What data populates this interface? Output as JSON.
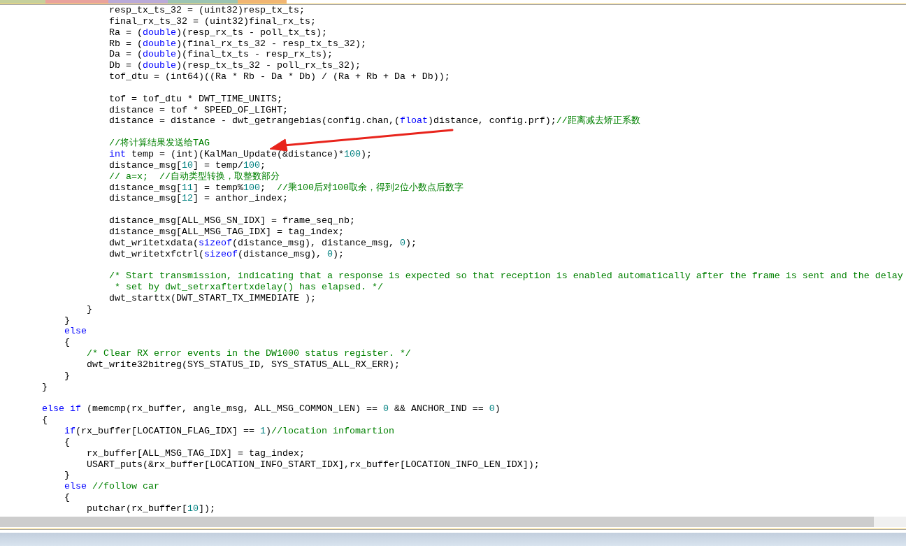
{
  "tabs": [
    {
      "color": "#c6d09c"
    },
    {
      "color": "#e9a39c"
    },
    {
      "color": "#baaad8"
    },
    {
      "color": "#9cc4b2"
    },
    {
      "color": "#f1b673"
    }
  ],
  "editor": {
    "lines": [
      {
        "kind": "code",
        "tokens": [
          {
            "kind": "plain",
            "text": "                resp_tx_ts_32 = (uint32)resp_tx_ts;"
          }
        ]
      },
      {
        "kind": "code",
        "tokens": [
          {
            "kind": "plain",
            "text": "                final_rx_ts_32 = (uint32)final_rx_ts;"
          }
        ]
      },
      {
        "kind": "code",
        "tokens": [
          {
            "kind": "plain",
            "text": "                Ra = ("
          },
          {
            "kind": "keyword",
            "text": "double"
          },
          {
            "kind": "plain",
            "text": ")(resp_rx_ts - poll_tx_ts);"
          }
        ]
      },
      {
        "kind": "code",
        "tokens": [
          {
            "kind": "plain",
            "text": "                Rb = ("
          },
          {
            "kind": "keyword",
            "text": "double"
          },
          {
            "kind": "plain",
            "text": ")(final_rx_ts_32 - resp_tx_ts_32);"
          }
        ]
      },
      {
        "kind": "code",
        "tokens": [
          {
            "kind": "plain",
            "text": "                Da = ("
          },
          {
            "kind": "keyword",
            "text": "double"
          },
          {
            "kind": "plain",
            "text": ")(final_tx_ts - resp_rx_ts);"
          }
        ]
      },
      {
        "kind": "code",
        "tokens": [
          {
            "kind": "plain",
            "text": "                Db = ("
          },
          {
            "kind": "keyword",
            "text": "double"
          },
          {
            "kind": "plain",
            "text": ")(resp_tx_ts_32 - poll_rx_ts_32);"
          }
        ]
      },
      {
        "kind": "code",
        "tokens": [
          {
            "kind": "plain",
            "text": "                tof_dtu = (int64)((Ra * Rb - Da * Db) / (Ra + Rb + Da + Db));"
          }
        ]
      },
      {
        "kind": "blank"
      },
      {
        "kind": "code",
        "tokens": [
          {
            "kind": "plain",
            "text": "                tof = tof_dtu * DWT_TIME_UNITS;"
          }
        ]
      },
      {
        "kind": "code",
        "tokens": [
          {
            "kind": "plain",
            "text": "                distance = tof * SPEED_OF_LIGHT;"
          }
        ]
      },
      {
        "kind": "code",
        "tokens": [
          {
            "kind": "plain",
            "text": "                distance = distance - dwt_getrangebias(config.chan,("
          },
          {
            "kind": "keyword",
            "text": "float"
          },
          {
            "kind": "plain",
            "text": ")distance, config.prf);"
          },
          {
            "kind": "comment",
            "text": "//距离减去矫正系数"
          }
        ]
      },
      {
        "kind": "blank"
      },
      {
        "kind": "code",
        "tokens": [
          {
            "kind": "comment",
            "text": "                //将计算结果发送给TAG"
          }
        ]
      },
      {
        "kind": "code",
        "tokens": [
          {
            "kind": "keyword",
            "text": "                int"
          },
          {
            "kind": "plain",
            "text": " temp = (int)(KalMan_Update(&distance)*"
          },
          {
            "kind": "number",
            "text": "100"
          },
          {
            "kind": "plain",
            "text": ");"
          }
        ]
      },
      {
        "kind": "code",
        "tokens": [
          {
            "kind": "plain",
            "text": "                distance_msg["
          },
          {
            "kind": "number",
            "text": "10"
          },
          {
            "kind": "plain",
            "text": "] = temp/"
          },
          {
            "kind": "number",
            "text": "100"
          },
          {
            "kind": "plain",
            "text": ";"
          }
        ]
      },
      {
        "kind": "code",
        "tokens": [
          {
            "kind": "comment",
            "text": "                // a=x;  //自动类型转换，取整数部分"
          }
        ]
      },
      {
        "kind": "code",
        "tokens": [
          {
            "kind": "plain",
            "text": "                distance_msg["
          },
          {
            "kind": "number",
            "text": "11"
          },
          {
            "kind": "plain",
            "text": "] = temp%"
          },
          {
            "kind": "number",
            "text": "100"
          },
          {
            "kind": "plain",
            "text": ";  "
          },
          {
            "kind": "comment",
            "text": "//乘100后对100取余，得到2位小数点后数字"
          }
        ]
      },
      {
        "kind": "code",
        "tokens": [
          {
            "kind": "plain",
            "text": "                distance_msg["
          },
          {
            "kind": "number",
            "text": "12"
          },
          {
            "kind": "plain",
            "text": "] = anthor_index;"
          }
        ]
      },
      {
        "kind": "blank"
      },
      {
        "kind": "code",
        "tokens": [
          {
            "kind": "plain",
            "text": "                distance_msg[ALL_MSG_SN_IDX] = frame_seq_nb;"
          }
        ]
      },
      {
        "kind": "code",
        "tokens": [
          {
            "kind": "plain",
            "text": "                distance_msg[ALL_MSG_TAG_IDX] = tag_index;"
          }
        ]
      },
      {
        "kind": "code",
        "tokens": [
          {
            "kind": "plain",
            "text": "                dwt_writetxdata("
          },
          {
            "kind": "keyword",
            "text": "sizeof"
          },
          {
            "kind": "plain",
            "text": "(distance_msg), distance_msg, "
          },
          {
            "kind": "number",
            "text": "0"
          },
          {
            "kind": "plain",
            "text": ");"
          }
        ]
      },
      {
        "kind": "code",
        "tokens": [
          {
            "kind": "plain",
            "text": "                dwt_writetxfctrl("
          },
          {
            "kind": "keyword",
            "text": "sizeof"
          },
          {
            "kind": "plain",
            "text": "(distance_msg), "
          },
          {
            "kind": "number",
            "text": "0"
          },
          {
            "kind": "plain",
            "text": ");"
          }
        ]
      },
      {
        "kind": "blank"
      },
      {
        "kind": "code",
        "tokens": [
          {
            "kind": "comment",
            "text": "                /* Start transmission, indicating that a response is expected so that reception is enabled automatically after the frame is sent and the delay"
          }
        ]
      },
      {
        "kind": "code",
        "tokens": [
          {
            "kind": "comment",
            "text": "                 * set by dwt_setrxaftertxdelay() has elapsed. */"
          }
        ]
      },
      {
        "kind": "code",
        "tokens": [
          {
            "kind": "plain",
            "text": "                dwt_starttx(DWT_START_TX_IMMEDIATE );"
          }
        ]
      },
      {
        "kind": "code",
        "tokens": [
          {
            "kind": "plain",
            "text": "            }"
          }
        ]
      },
      {
        "kind": "code",
        "tokens": [
          {
            "kind": "plain",
            "text": "        }"
          }
        ]
      },
      {
        "kind": "code",
        "tokens": [
          {
            "kind": "keyword",
            "text": "        else"
          }
        ]
      },
      {
        "kind": "code",
        "tokens": [
          {
            "kind": "plain",
            "text": "        {"
          }
        ]
      },
      {
        "kind": "code",
        "tokens": [
          {
            "kind": "comment",
            "text": "            /* Clear RX error events in the DW1000 status register. */"
          }
        ]
      },
      {
        "kind": "code",
        "tokens": [
          {
            "kind": "plain",
            "text": "            dwt_write32bitreg(SYS_STATUS_ID, SYS_STATUS_ALL_RX_ERR);"
          }
        ]
      },
      {
        "kind": "code",
        "tokens": [
          {
            "kind": "plain",
            "text": "        }"
          }
        ]
      },
      {
        "kind": "code",
        "tokens": [
          {
            "kind": "plain",
            "text": "    }"
          }
        ]
      },
      {
        "kind": "blank"
      },
      {
        "kind": "code",
        "tokens": [
          {
            "kind": "keyword",
            "text": "    else if"
          },
          {
            "kind": "plain",
            "text": " (memcmp(rx_buffer, angle_msg, ALL_MSG_COMMON_LEN) == "
          },
          {
            "kind": "number",
            "text": "0"
          },
          {
            "kind": "plain",
            "text": " && ANCHOR_IND == "
          },
          {
            "kind": "number",
            "text": "0"
          },
          {
            "kind": "plain",
            "text": ")"
          }
        ]
      },
      {
        "kind": "code",
        "tokens": [
          {
            "kind": "plain",
            "text": "    {"
          }
        ]
      },
      {
        "kind": "code",
        "tokens": [
          {
            "kind": "keyword",
            "text": "        if"
          },
          {
            "kind": "plain",
            "text": "(rx_buffer[LOCATION_FLAG_IDX] == "
          },
          {
            "kind": "number",
            "text": "1"
          },
          {
            "kind": "plain",
            "text": ")"
          },
          {
            "kind": "comment",
            "text": "//location infomartion"
          }
        ]
      },
      {
        "kind": "code",
        "tokens": [
          {
            "kind": "plain",
            "text": "        {"
          }
        ]
      },
      {
        "kind": "code",
        "tokens": [
          {
            "kind": "plain",
            "text": "            rx_buffer[ALL_MSG_TAG_IDX] = tag_index;"
          }
        ]
      },
      {
        "kind": "code",
        "tokens": [
          {
            "kind": "plain",
            "text": "            USART_puts(&rx_buffer[LOCATION_INFO_START_IDX],rx_buffer[LOCATION_INFO_LEN_IDX]);"
          }
        ]
      },
      {
        "kind": "code",
        "tokens": [
          {
            "kind": "plain",
            "text": "        }"
          }
        ]
      },
      {
        "kind": "code",
        "tokens": [
          {
            "kind": "keyword",
            "text": "        else"
          },
          {
            "kind": "comment",
            "text": " //follow car"
          }
        ]
      },
      {
        "kind": "code",
        "tokens": [
          {
            "kind": "plain",
            "text": "        {"
          }
        ]
      },
      {
        "kind": "code",
        "tokens": [
          {
            "kind": "plain",
            "text": "            putchar(rx_buffer["
          },
          {
            "kind": "number",
            "text": "10"
          },
          {
            "kind": "plain",
            "text": "]);"
          }
        ]
      }
    ]
  }
}
